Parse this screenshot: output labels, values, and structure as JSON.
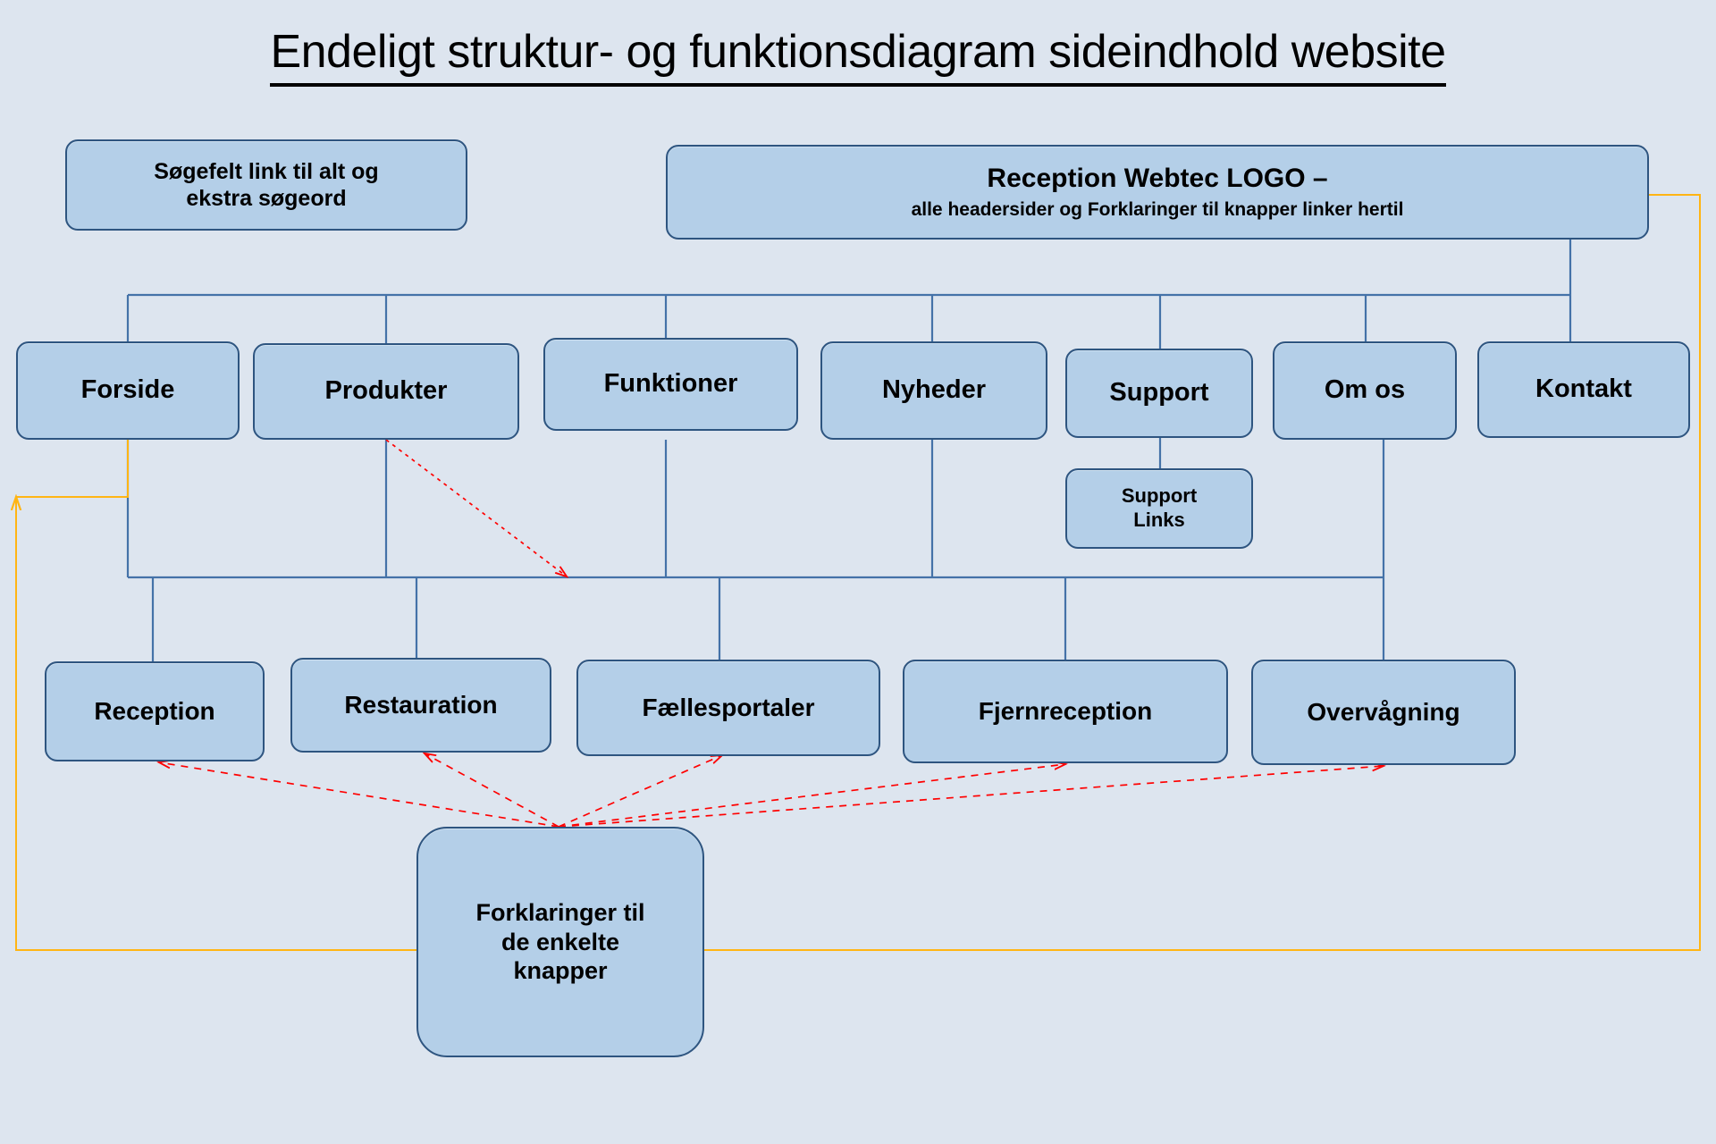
{
  "page": {
    "title": "Endeligt struktur- og funktionsdiagram sideindhold website",
    "background_color": "#dde5ef"
  },
  "colors": {
    "node_fill": "#b4cfe8",
    "node_border": "#2e5580",
    "connector": "#4472a8",
    "red_link": "#ff0000",
    "orange_link": "#ffb514"
  },
  "search_box": {
    "line1": "Søgefelt link til alt og",
    "line2": "ekstra søgeord"
  },
  "header_box": {
    "line1": "Reception Webtec LOGO –",
    "line2": "alle headersider og Forklaringer til knapper linker hertil"
  },
  "nav": {
    "items": [
      {
        "label": "Forside"
      },
      {
        "label": "Produkter"
      },
      {
        "label": "Funktioner"
      },
      {
        "label": "Nyheder"
      },
      {
        "label": "Support"
      },
      {
        "label": "Om os"
      },
      {
        "label": "Kontakt"
      }
    ]
  },
  "support_links": {
    "line1": "Support",
    "line2": "Links"
  },
  "sections": {
    "items": [
      {
        "label": "Reception"
      },
      {
        "label": "Restauration"
      },
      {
        "label": "Fællesportaler"
      },
      {
        "label": "Fjernreception"
      },
      {
        "label": "Overvågning"
      }
    ]
  },
  "explain_box": {
    "line1": "Forklaringer til",
    "line2": "de enkelte",
    "line3": "knapper"
  }
}
